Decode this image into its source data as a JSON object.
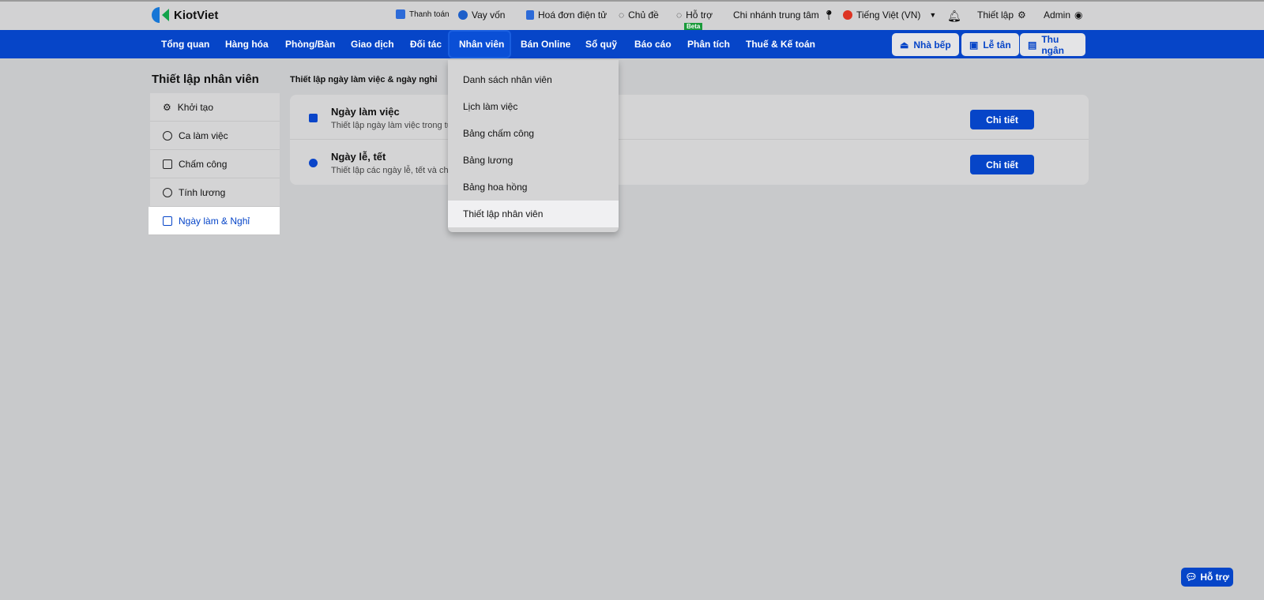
{
  "brand": "KiotViet",
  "topbar": {
    "payment": "Thanh toán",
    "loan": "Vay vốn",
    "einvoice": "Hoá đơn điện tử",
    "theme": "Chủ đề",
    "support": "Hỗ trợ",
    "beta": "Beta",
    "branch": "Chi nhánh trung tâm",
    "language": "Tiếng Việt (VN)",
    "settings": "Thiết lập",
    "user": "Admin"
  },
  "nav": {
    "items": [
      "Tổng quan",
      "Hàng hóa",
      "Phòng/Bàn",
      "Giao dịch",
      "Đối tác",
      "Nhân viên",
      "Bán Online",
      "Sổ quỹ",
      "Báo cáo",
      "Phân tích",
      "Thuế & Kế toán"
    ],
    "kitchen": "Nhà bếp",
    "reception": "Lễ tân",
    "cashier": "Thu ngân"
  },
  "page_title": "Thiết lập nhân viên",
  "sidebar": [
    "Khởi tạo",
    "Ca làm việc",
    "Chấm công",
    "Tính lương",
    "Ngày làm & Nghỉ"
  ],
  "section_title": "Thiết lập ngày làm việc & ngày nghỉ",
  "rows": [
    {
      "title": "Ngày làm việc",
      "desc": "Thiết lập ngày làm việc trong tu",
      "button": "Chi tiết"
    },
    {
      "title": "Ngày lễ, tết",
      "desc": "Thiết lập các ngày lễ, tết và chín",
      "button": "Chi tiết"
    }
  ],
  "dropdown": [
    "Danh sách nhân viên",
    "Lịch làm việc",
    "Bảng chấm công",
    "Bảng lương",
    "Bảng hoa hồng",
    "Thiết lập nhân viên"
  ],
  "help": "Hỗ trợ"
}
